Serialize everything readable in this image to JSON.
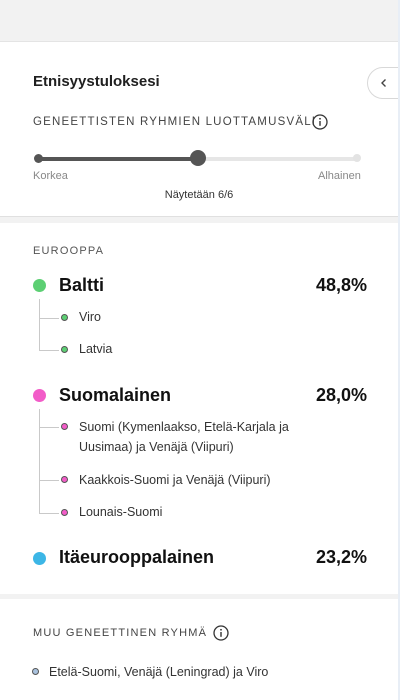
{
  "panel": {
    "title": "Etnisyystuloksesi",
    "confidence_label": "GENEETTISTEN RYHMIEN LUOTTAMUSVÄLI",
    "slider": {
      "left_label": "Korkea",
      "right_label": "Alhainen",
      "level_fraction": 0.5
    },
    "showing_text": "Näytetään 6/6"
  },
  "region": {
    "label": "EUROOPPA",
    "groups": [
      {
        "name": "Baltti",
        "percent": "48,8%",
        "color": "#5ccf73",
        "subgroups": [
          {
            "name": "Viro",
            "color": "#5ccf73"
          },
          {
            "name": "Latvia",
            "color": "#5ccf73"
          }
        ]
      },
      {
        "name": "Suomalainen",
        "percent": "28,0%",
        "color": "#f25cc8",
        "subgroups": [
          {
            "name_line1": "Suomi (Kymenlaakso, Etelä-Karjala ja",
            "name_line2": "Uusimaa) ja Venäjä (Viipuri)",
            "color": "#f25cc8"
          },
          {
            "name": "Kaakkois-Suomi ja Venäjä (Viipuri)",
            "color": "#f25cc8"
          },
          {
            "name": "Lounais-Suomi",
            "color": "#f25cc8"
          }
        ]
      },
      {
        "name": "Itäeurooppalainen",
        "percent": "23,2%",
        "color": "#3cb6e6",
        "subgroups": []
      }
    ]
  },
  "other": {
    "label": "MUU GENEETTINEN RYHMÄ",
    "items": [
      {
        "name": "Etelä-Suomi, Venäjä (Leningrad) ja Viro",
        "color": "#a9c2de"
      }
    ]
  },
  "icons": {
    "collapse": "chevron-left-icon",
    "info": "info-icon"
  }
}
